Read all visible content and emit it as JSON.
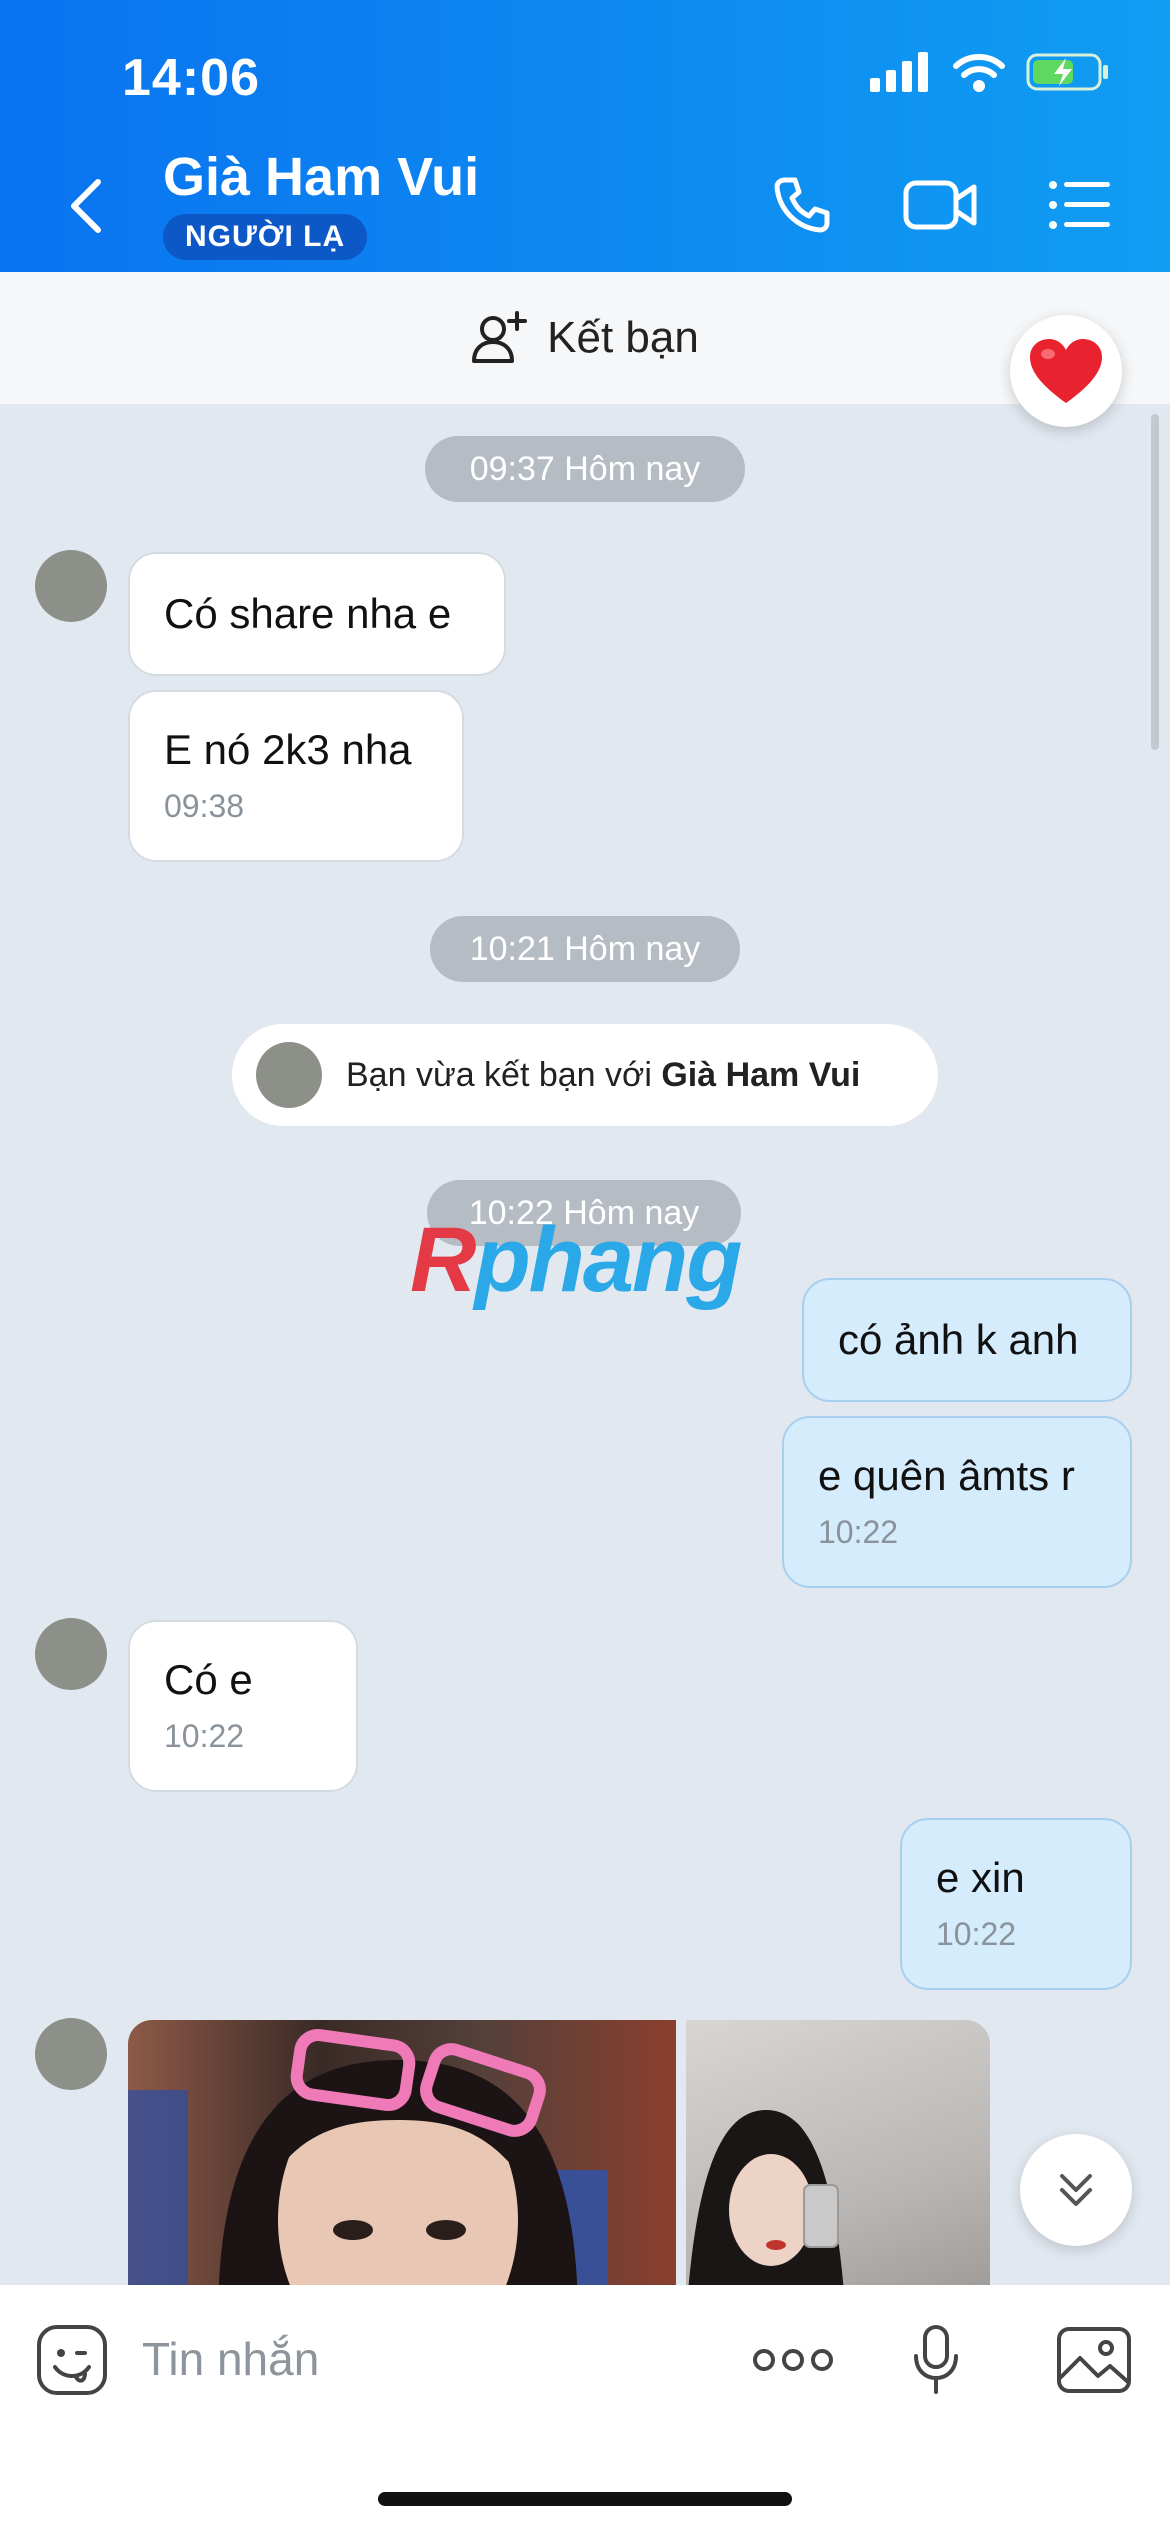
{
  "status_bar": {
    "time": "14:06"
  },
  "header": {
    "contact_name": "Già Ham Vui",
    "badge": "NGƯỜI LẠ",
    "accent": "#0a73f0"
  },
  "friend_bar": {
    "label": "Kết bạn"
  },
  "messages": {
    "pill1": "09:37 Hôm nay",
    "m1": {
      "text": "Có share nha e"
    },
    "m2": {
      "text": "E nó 2k3 nha",
      "time": "09:38"
    },
    "pill2": "10:21 Hôm nay",
    "system": {
      "prefix": "Bạn vừa kết bạn với ",
      "name": "Già Ham Vui"
    },
    "pill3": "10:22 Hôm nay",
    "m3": {
      "text": "có ảnh k anh"
    },
    "m4": {
      "text": "e quên âmts r",
      "time": "10:22"
    },
    "m5": {
      "text": "Có e",
      "time": "10:22"
    },
    "m6": {
      "text": "e xin",
      "time": "10:22"
    }
  },
  "watermark": {
    "part1": "R",
    "part2": "phang"
  },
  "input": {
    "placeholder": "Tin nhắn"
  },
  "icons": [
    "back-icon",
    "phone-icon",
    "video-call-icon",
    "menu-list-icon",
    "add-friend-icon",
    "heart-icon",
    "scroll-down-icon",
    "sticker-icon",
    "more-icon",
    "microphone-icon",
    "image-icon"
  ]
}
